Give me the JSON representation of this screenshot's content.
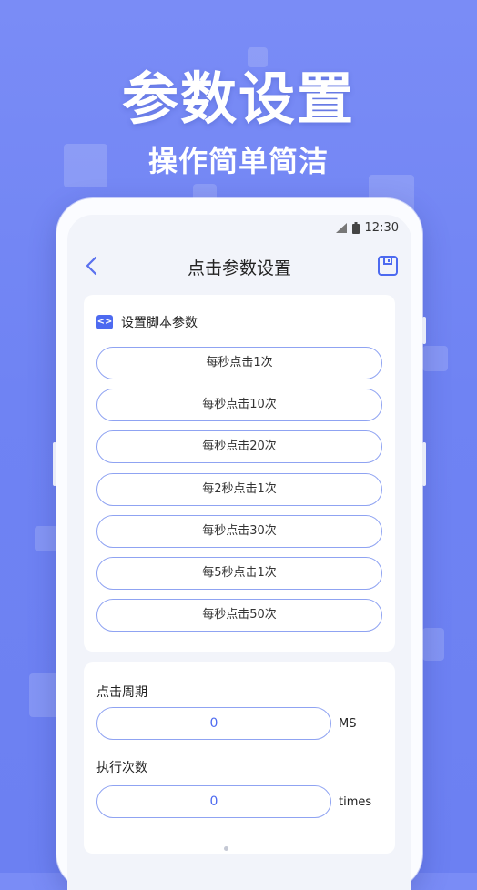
{
  "hero": {
    "title": "参数设置",
    "subtitle": "操作简单简洁"
  },
  "status_bar": {
    "time": "12:30"
  },
  "nav": {
    "title": "点击参数设置"
  },
  "script_params": {
    "title": "设置脚本参数",
    "options": [
      "每秒点击1次",
      "每秒点击10次",
      "每秒点击20次",
      "每2秒点击1次",
      "每秒点击30次",
      "每5秒点击1次",
      "每秒点击50次"
    ]
  },
  "fields": {
    "click_period": {
      "label": "点击周期",
      "value": "0",
      "unit": "MS"
    },
    "exec_count": {
      "label": "执行次数",
      "value": "0",
      "unit": "times"
    }
  },
  "colors": {
    "accent": "#4d6af0",
    "background": "#6f83f3",
    "border": "#8fa3f2"
  }
}
